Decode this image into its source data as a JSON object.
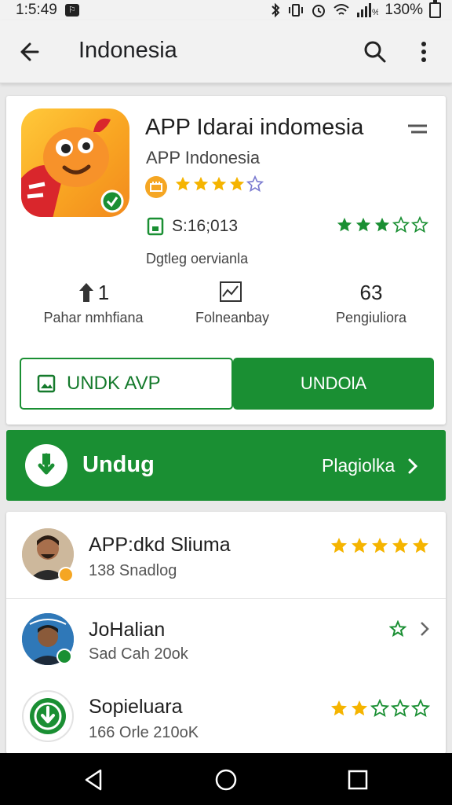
{
  "status_bar": {
    "time": "1:5:49",
    "battery_text": "130%",
    "icons": [
      "notification-icon",
      "bluetooth-icon",
      "vibrate-icon",
      "alarm-icon",
      "wifi-icon",
      "signal-icon",
      "battery-icon"
    ]
  },
  "app_bar": {
    "title": "Indonesia",
    "icons": [
      "back-arrow-icon",
      "search-icon",
      "more-vert-icon"
    ]
  },
  "app_card": {
    "title": "APP Idarai indomesia",
    "developer": "APP Indonesia",
    "rating_stars": 4,
    "rating_max": 5,
    "meta_text": "S:16;013",
    "meta_rating_stars": 3,
    "category": "Dgtleg oervianla",
    "stats": [
      {
        "value": "1",
        "label": "Pahar nmhfiana",
        "icon": "upload-person-icon"
      },
      {
        "value": "",
        "label": "Folneanbay",
        "icon": "chart-icon"
      },
      {
        "value": "63",
        "label": "Pengiuliora",
        "icon": ""
      }
    ],
    "button_outline_label": "UNDK AVP",
    "button_filled_label": "UNDOlA"
  },
  "download_banner": {
    "title": "Undug",
    "link_label": "Plagiolka"
  },
  "list": [
    {
      "title": "APP:dkd Sliuma",
      "subtitle": "138 Snadlog",
      "stars": 5
    },
    {
      "title": "JoHalian",
      "subtitle": "Sad Cah 20ok",
      "stars": 0
    },
    {
      "title": "Sopieluara",
      "subtitle": "166 Orle 210oK",
      "stars": 2
    }
  ],
  "nav_bar": {
    "icons": [
      "back-triangle-icon",
      "home-circle-icon",
      "recents-square-icon"
    ]
  },
  "colors": {
    "primary_green": "#1a8f33",
    "star_gold": "#f5b400",
    "appbar_bg": "#f2f2f2"
  }
}
